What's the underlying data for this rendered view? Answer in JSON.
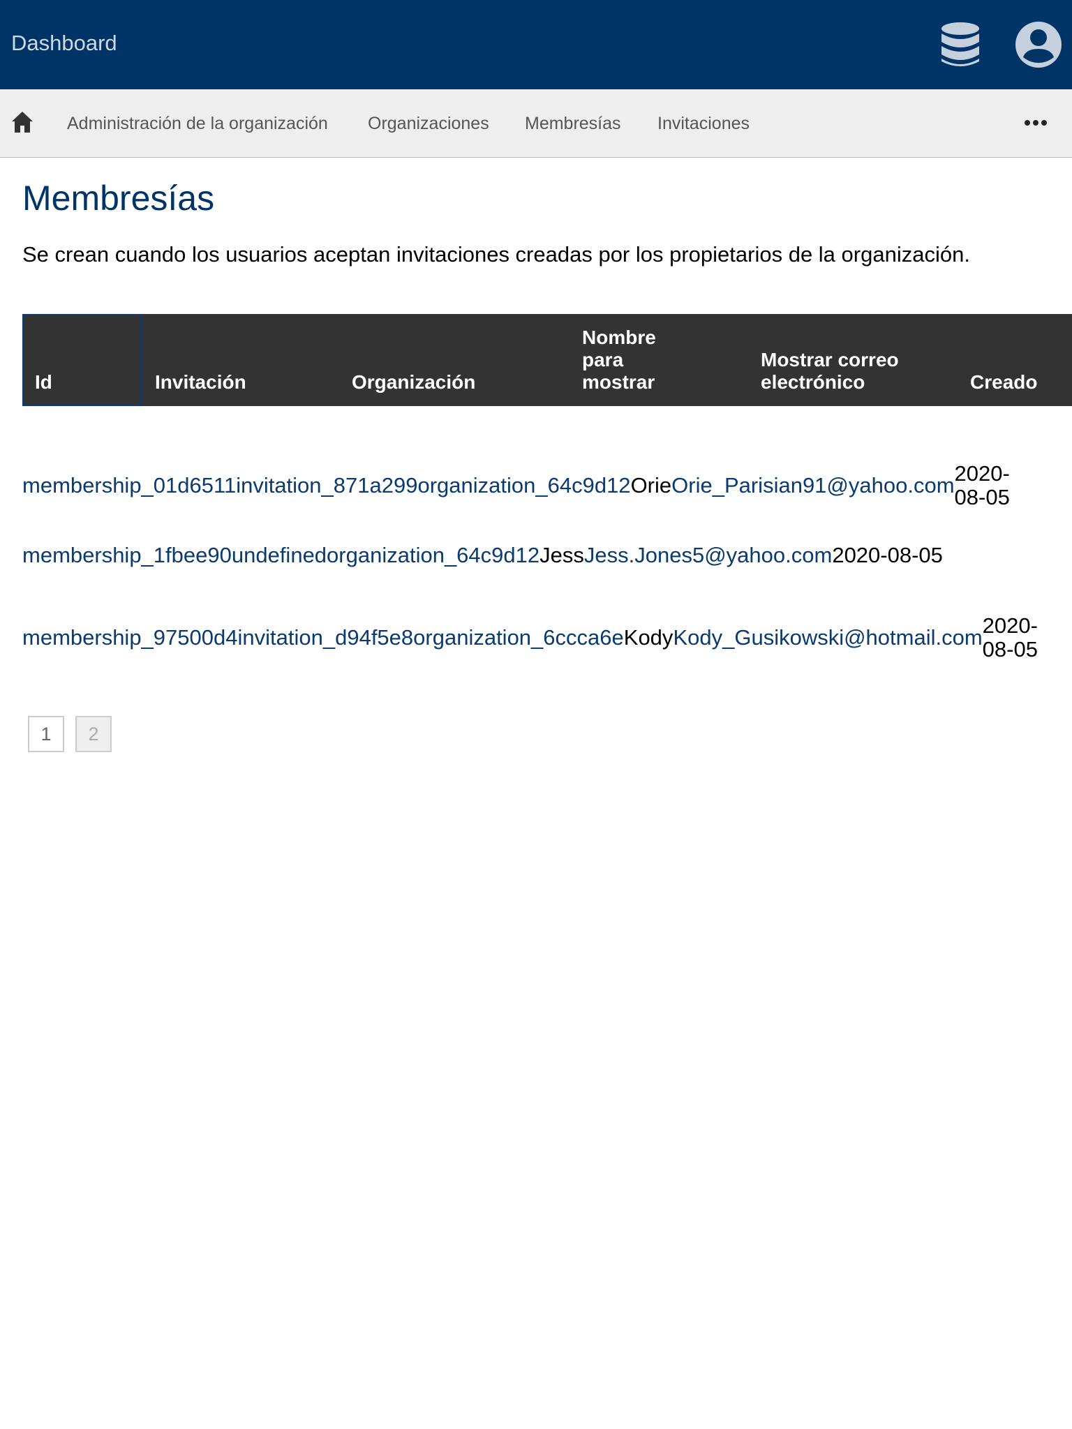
{
  "header": {
    "brand": "Dashboard",
    "icons": [
      "database-icon",
      "account-circle-icon"
    ]
  },
  "nav": {
    "home_icon": "home-icon",
    "items": [
      {
        "label": "Administración de la organización"
      },
      {
        "label": "Organizaciones"
      },
      {
        "label": "Membresías"
      },
      {
        "label": "Invitaciones"
      }
    ],
    "more_icon": "more-horizontal-icon"
  },
  "page": {
    "title": "Membresías",
    "description": "Se crean cuando los usuarios aceptan invitaciones creadas por los propietarios de la organización."
  },
  "table": {
    "columns": [
      {
        "label": "Id"
      },
      {
        "label": "Invitación"
      },
      {
        "label": "Organización"
      },
      {
        "label": "Nombre para mostrar"
      },
      {
        "label": "Mostrar correo electrónico"
      },
      {
        "label": "Creado"
      }
    ],
    "rows": [
      {
        "id": "membership_01d6511",
        "invitation": "invitation_871a299",
        "organization": "organization_64c9d12",
        "display_name": "Orie",
        "email": "Orie_Parisian91@yahoo.com",
        "created": "2020-08-05"
      },
      {
        "id": "membership_1fbee90",
        "invitation": "undefined",
        "organization": "organization_64c9d12",
        "display_name": "Jess",
        "email": "Jess.Jones5@yahoo.com",
        "created": "2020-08-05"
      },
      {
        "id": "membership_97500d4",
        "invitation": "invitation_d94f5e8",
        "organization": "organization_6ccca6e",
        "display_name": "Kody",
        "email": "Kody_Gusikowski@hotmail.com",
        "created": "2020-08-05"
      }
    ]
  },
  "pagination": {
    "pages": [
      "1",
      "2"
    ],
    "current_page": "2"
  },
  "colors": {
    "header_bg": "#003366",
    "nav_bg": "#eeeeee",
    "table_header_bg": "#333333",
    "link": "#0b3a6f"
  }
}
